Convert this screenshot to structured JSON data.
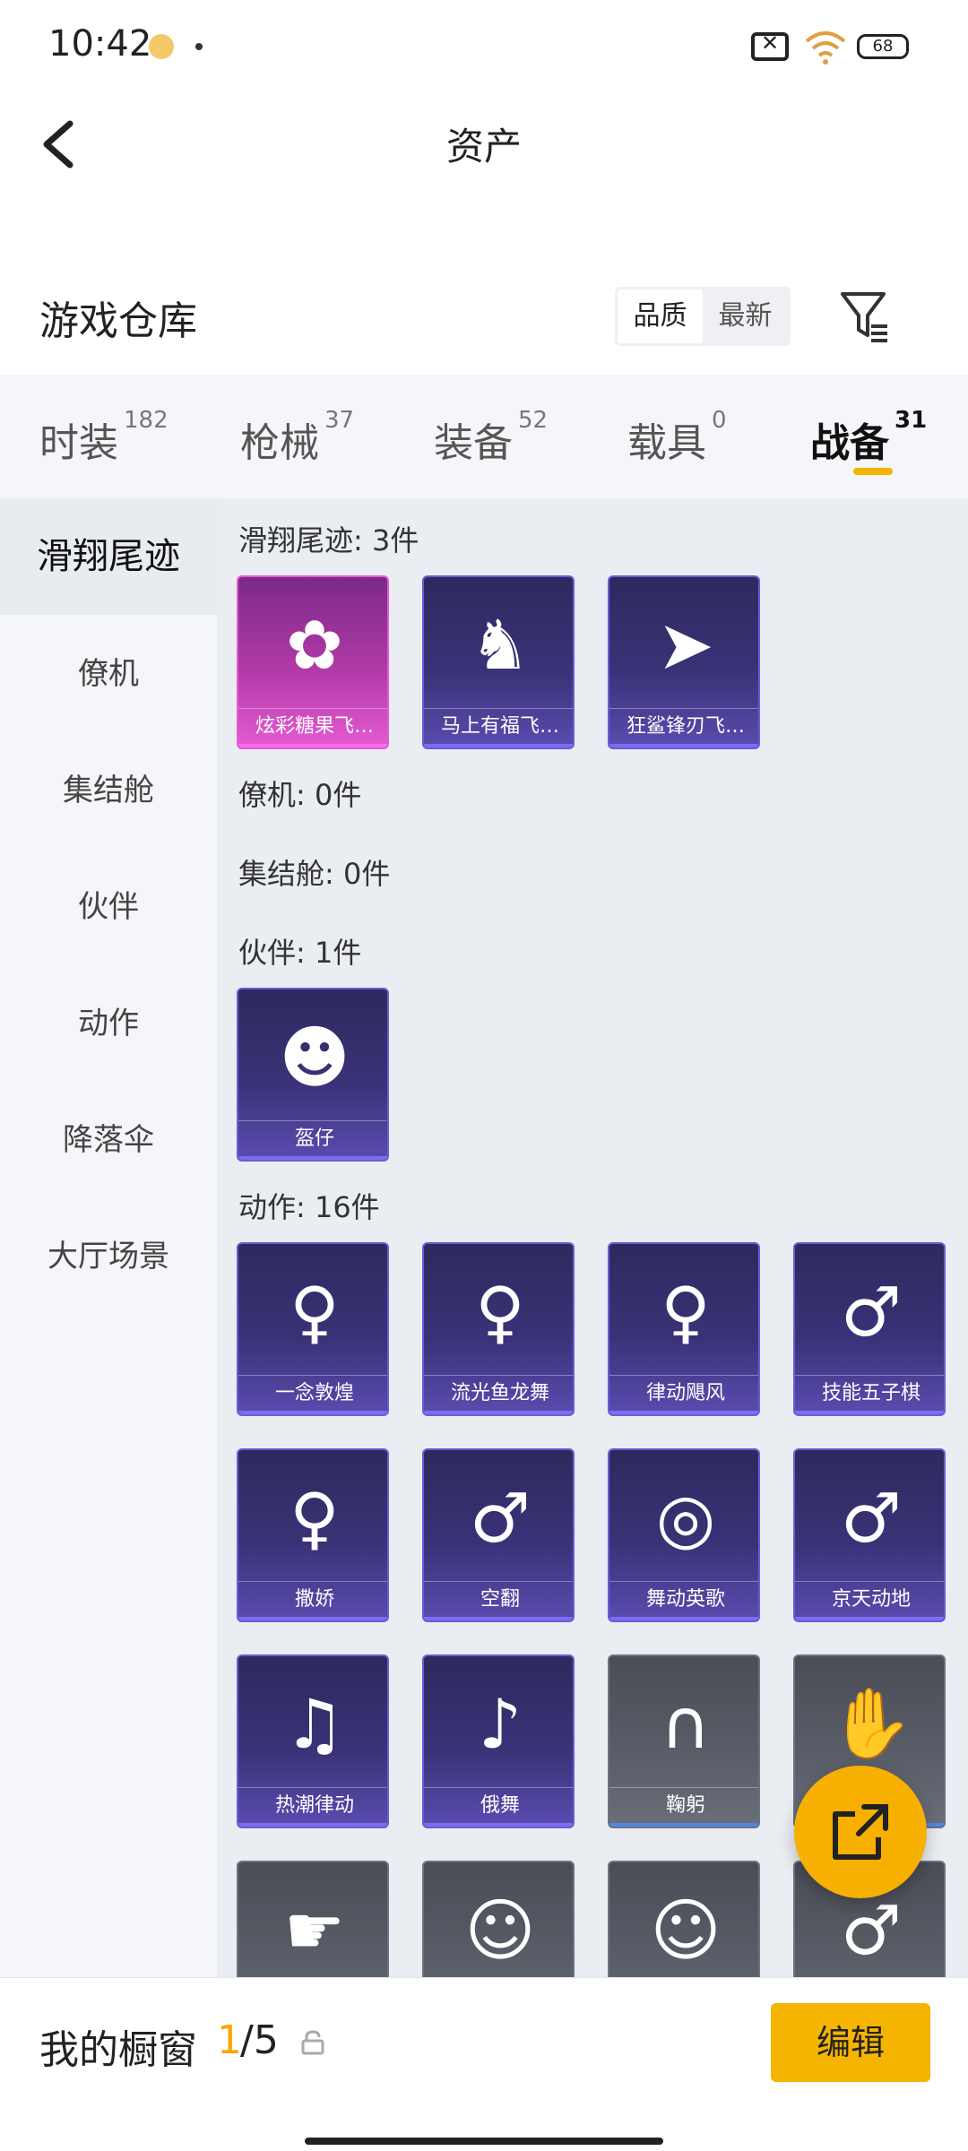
{
  "status_bar": {
    "time": "10:42",
    "battery": "68"
  },
  "header": {
    "title": "资产"
  },
  "warehouse": {
    "title": "游戏仓库",
    "sort_quality": "品质",
    "sort_newest": "最新"
  },
  "tabs": [
    {
      "label": "时装",
      "count": "182"
    },
    {
      "label": "枪械",
      "count": "37"
    },
    {
      "label": "装备",
      "count": "52"
    },
    {
      "label": "载具",
      "count": "0"
    },
    {
      "label": "战备",
      "count": "31"
    }
  ],
  "side_nav": [
    "滑翔尾迹",
    "僚机",
    "集结舱",
    "伙伴",
    "动作",
    "降落伞",
    "大厅场景"
  ],
  "sections": {
    "glide": {
      "heading": "滑翔尾迹: 3件",
      "items": [
        "炫彩糖果飞…",
        "马上有福飞…",
        "狂鲨锋刃飞…"
      ]
    },
    "wingman": {
      "heading": "僚机: 0件"
    },
    "pod": {
      "heading": "集结舱: 0件"
    },
    "partner": {
      "heading": "伙伴: 1件",
      "items": [
        "盔仔"
      ]
    },
    "emote": {
      "heading": "动作: 16件",
      "items": [
        "一念敦煌",
        "流光鱼龙舞",
        "律动飓风",
        "技能五子棋",
        "撒娇",
        "空翻",
        "舞动英歌",
        "京天动地",
        "热潮律动",
        "俄舞",
        "鞠躬"
      ]
    }
  },
  "bottom_bar": {
    "showcase_label": "我的橱窗",
    "showcase_current": "1",
    "showcase_total": "/5",
    "edit_label": "编辑"
  },
  "colors": {
    "accent": "#f5b400",
    "card_purple": "#3a3277",
    "card_pink": "#b23aa8",
    "card_gray": "#5a5e68"
  },
  "icons": [
    "back-arrow-icon",
    "filter-icon",
    "lock-icon",
    "share-icon"
  ]
}
